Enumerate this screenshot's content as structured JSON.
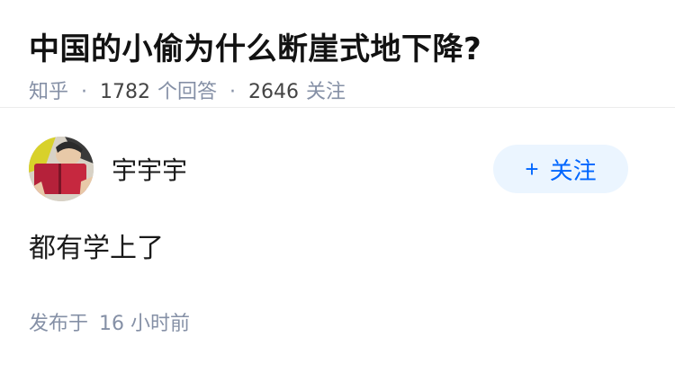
{
  "question": {
    "title": "中国的小偷为什么断崖式地下降?",
    "source": "知乎",
    "answer_count": "1782",
    "answer_label": "个回答",
    "follow_count": "2646",
    "follow_label": "关注"
  },
  "answer": {
    "author_name": "宇宇宇",
    "avatar_icon": "avatar-illustration",
    "follow_button": {
      "plus": "+",
      "label": "关注"
    },
    "content": "都有学上了",
    "time_prefix": "发布于",
    "time_value": "16 小时前"
  },
  "colors": {
    "accent": "#0066ff",
    "accent_bg": "#ebf5ff",
    "meta_gray": "#8590a6"
  }
}
